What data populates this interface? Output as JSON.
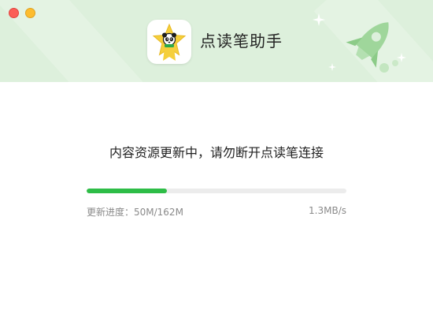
{
  "window": {
    "controls": [
      "close",
      "minimize"
    ]
  },
  "header": {
    "app_icon": "panda-star-icon",
    "title": "点读笔助手",
    "decoration_icons": [
      "rocket-icon",
      "sparkle-icon"
    ],
    "colors": {
      "background": "#ddf0dc",
      "accent": "#8dcf8a"
    }
  },
  "main": {
    "message": "内容资源更新中，请勿断开点读笔连接",
    "progress": {
      "label_prefix": "更新进度：",
      "current": "50M",
      "total": "162M",
      "label": "更新进度：50M/162M",
      "speed": "1.3MB/s",
      "fraction": 0.31,
      "fill_color": "#2ebd47"
    }
  }
}
